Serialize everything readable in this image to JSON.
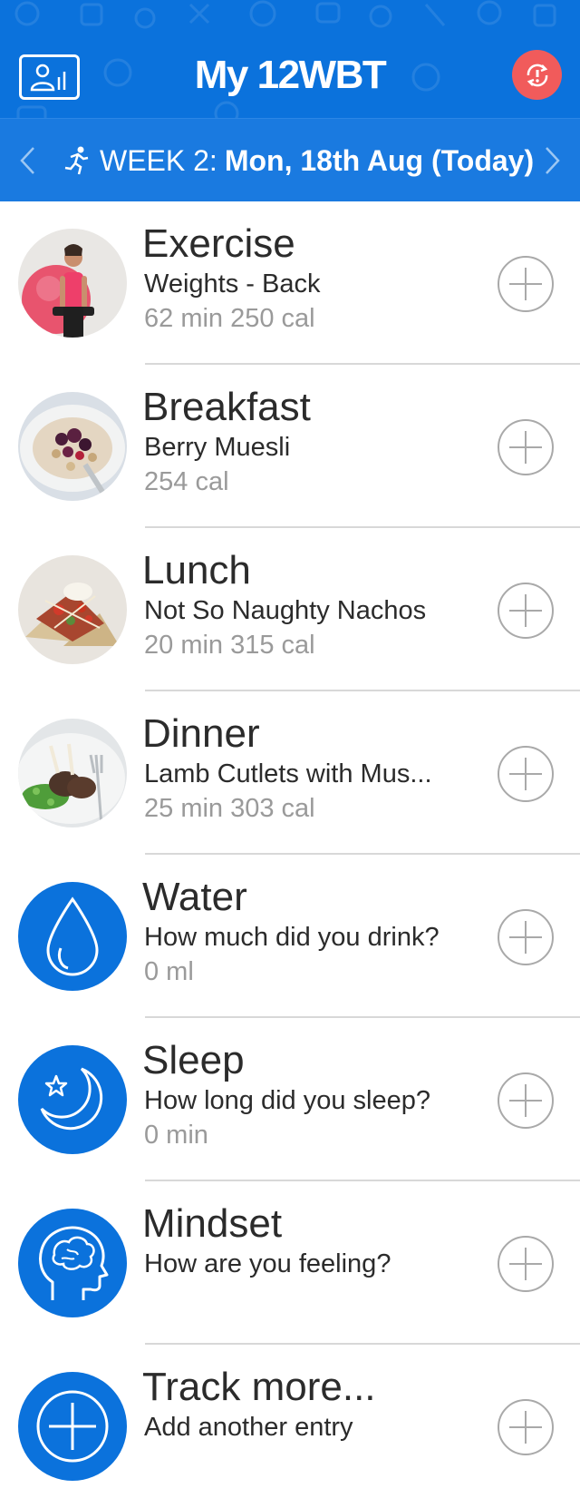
{
  "header": {
    "title": "My 12WBT",
    "profile_icon": "profile-stats-icon",
    "alert_icon": "sync-alert-icon",
    "brand_color": "#0b72dc",
    "alert_color": "#f15b5b"
  },
  "week_nav": {
    "week": "WEEK 2",
    "separator": ":",
    "date": "Mon, 18th Aug (Today)",
    "prev_icon": "chevron-left-icon",
    "next_icon": "chevron-right-icon",
    "runner_icon": "runner-icon"
  },
  "entries": [
    {
      "title": "Exercise",
      "subtitle": "Weights - Back",
      "meta": "62 min  250 cal",
      "thumb": "exercise-photo"
    },
    {
      "title": "Breakfast",
      "subtitle": "Berry Muesli",
      "meta": "254 cal",
      "thumb": "breakfast-photo"
    },
    {
      "title": "Lunch",
      "subtitle": "Not So Naughty Nachos",
      "meta": "20 min  315 cal",
      "thumb": "lunch-photo"
    },
    {
      "title": "Dinner",
      "subtitle": "Lamb Cutlets with Mus...",
      "meta": "25 min  303 cal",
      "thumb": "dinner-photo"
    },
    {
      "title": "Water",
      "subtitle": "How much did you drink?",
      "meta": "0 ml",
      "thumb": "water-drop-icon"
    },
    {
      "title": "Sleep",
      "subtitle": "How long did you sleep?",
      "meta": "0 min",
      "thumb": "moon-star-icon"
    },
    {
      "title": "Mindset",
      "subtitle": "How are you feeling?",
      "meta": "",
      "thumb": "head-brain-icon"
    },
    {
      "title": "Track more...",
      "subtitle": "Add another entry",
      "meta": "",
      "thumb": "plus-circle-icon"
    }
  ]
}
